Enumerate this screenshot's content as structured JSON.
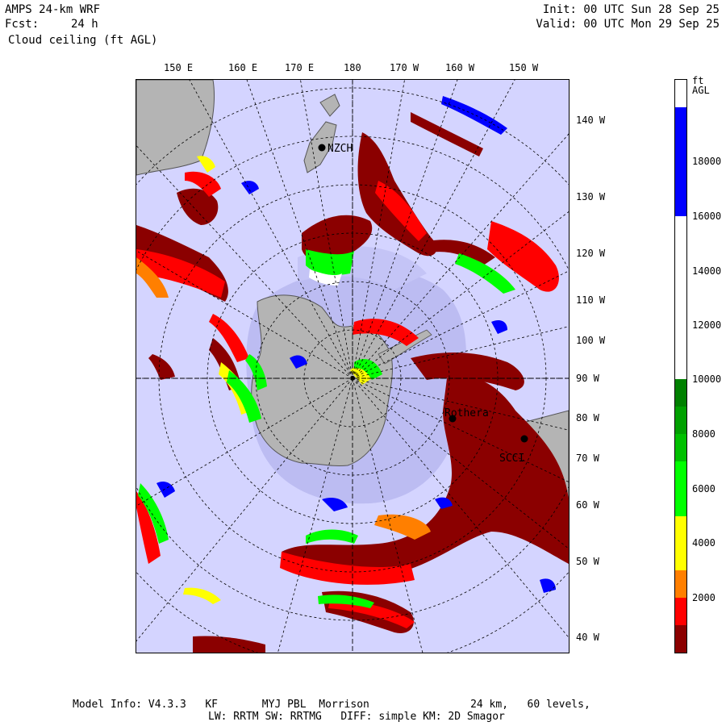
{
  "header": {
    "model_title": "AMPS 24-km WRF",
    "fcst_label": "Fcst:",
    "fcst_value": "24 h",
    "field_name": "Cloud ceiling (ft AGL)",
    "init_line": "Init: 00 UTC Sun 28 Sep 25",
    "valid_line": "Valid: 00 UTC Mon 29 Sep 25"
  },
  "map": {
    "top_longitudes": [
      "150 E",
      "160 E",
      "170 E",
      "180",
      "170 W",
      "160 W",
      "150 W"
    ],
    "right_longitudes": [
      "140 W",
      "130 W",
      "120 W",
      "110 W",
      "100 W",
      "90 W",
      "80 W",
      "70 W",
      "60 W",
      "50 W",
      "40 W"
    ],
    "stations": [
      "NZCH",
      "Rothera",
      "SCCI"
    ],
    "colors": {
      "ocean": "#d4d4ff",
      "sea_ice": "#bcbcf2",
      "land": "#b4b4b4",
      "ceiling_low": "#8b0000",
      "ceiling_2000": "#ff0000",
      "ceiling_3000": "#ff7f00",
      "ceiling_4000": "#ffff00",
      "ceiling_6000": "#00ff00",
      "ceiling_8000": "#00b300",
      "ceiling_high": "#0000ff"
    }
  },
  "colorbar": {
    "unit": "ft AGL",
    "ticks": [
      "18000",
      "16000",
      "14000",
      "12000",
      "10000",
      "8000",
      "6000",
      "4000",
      "2000"
    ]
  },
  "footer": {
    "line1": "Model Info: V4.3.3   KF       MYJ PBL  Morrison                24 km,   60 levels,",
    "line2": "LW: RRTM SW: RRTMG   DIFF: simple KM: 2D Smagor"
  }
}
